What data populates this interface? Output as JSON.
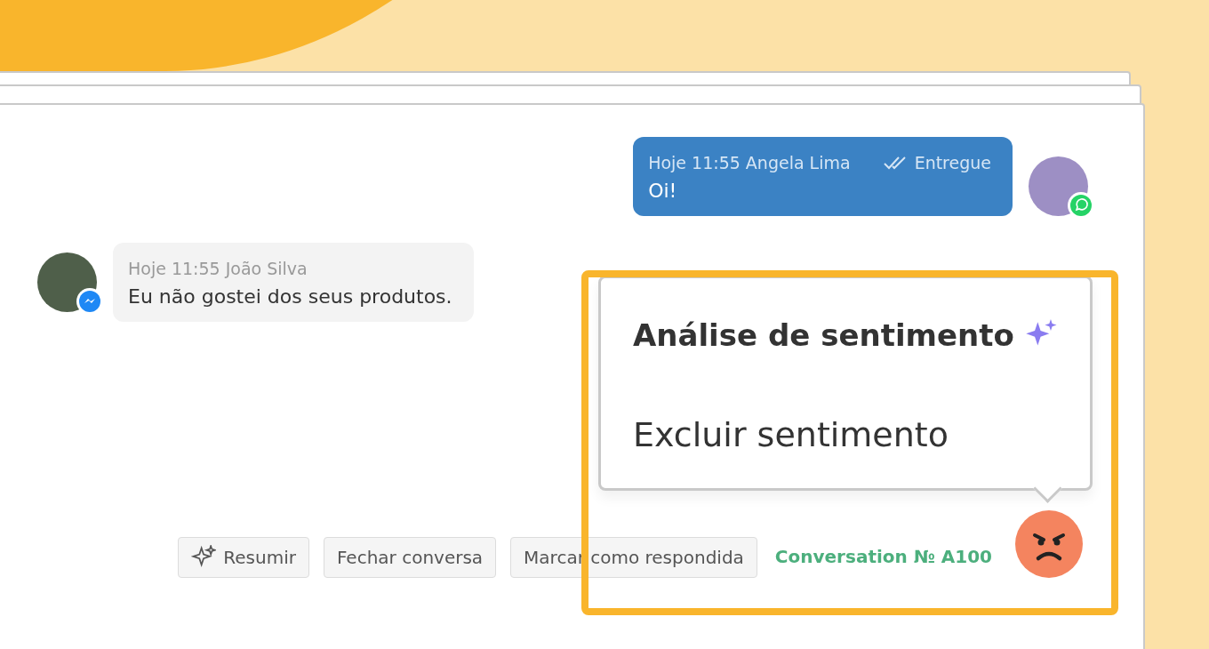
{
  "messages": [
    {
      "kind": "outgoing",
      "meta": "Hoje 11:55 Angela Lima",
      "status": "Entregue",
      "text": "Oi!",
      "channel_badge": {
        "kind": "whatsapp"
      }
    },
    {
      "kind": "incoming",
      "meta": "Hoje 11:55 João Silva",
      "text": "Eu não gostei dos seus produtos.",
      "channel_badge": {
        "kind": "messenger"
      }
    }
  ],
  "sentiment_menu": {
    "title": "Análise de sentimento",
    "items": [
      "Excluir sentimento"
    ]
  },
  "actions": [
    {
      "kind": "ai",
      "label": "Resumir"
    },
    {
      "kind": "plain",
      "label": "Fechar conversa"
    },
    {
      "kind": "plain",
      "label": "Marcar como respondida"
    }
  ],
  "conversation_label": "Conversation № A100",
  "sentiment_icon": {
    "kind": "angry"
  }
}
